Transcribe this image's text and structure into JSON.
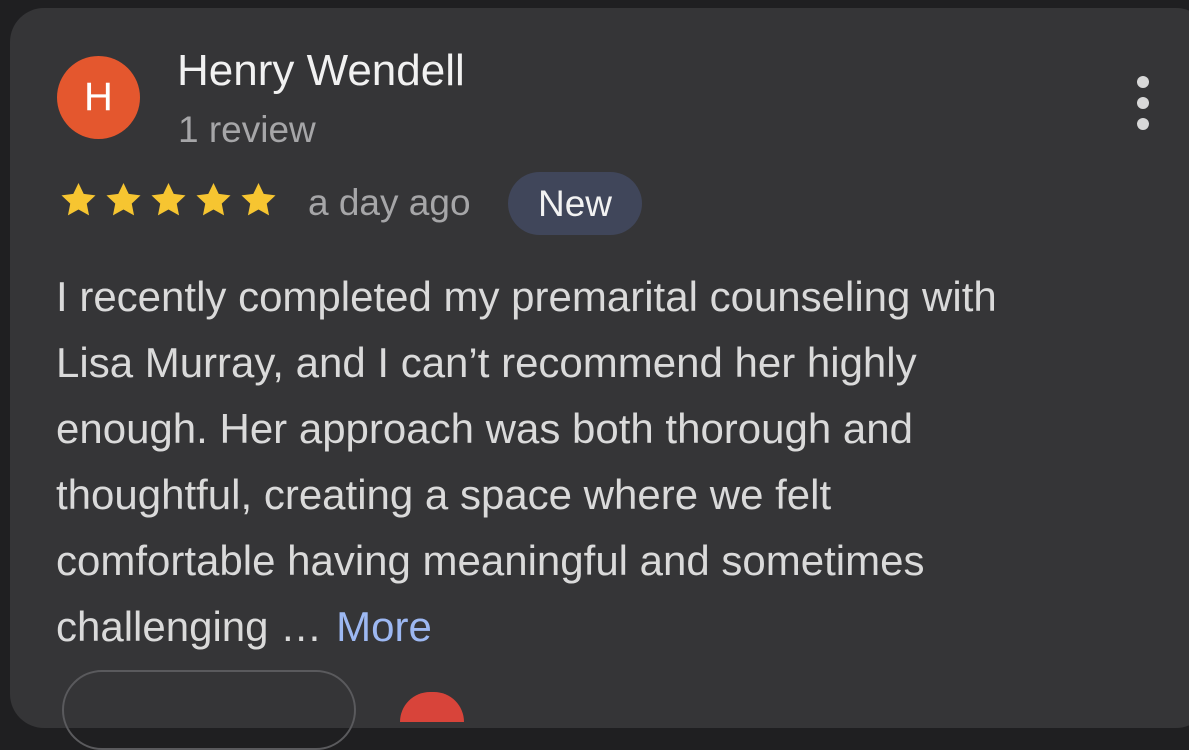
{
  "review": {
    "avatar_letter": "H",
    "author_name": "Henry Wendell",
    "author_meta": "1 review",
    "rating": 5,
    "rating_max": 5,
    "date": "a day ago",
    "badge": "New",
    "body_lines": [
      "I recently completed my premarital counseling with",
      "Lisa Murray, and I can’t recommend her highly",
      "enough. Her approach was both thorough and",
      "thoughtful, creating a space where we felt",
      "comfortable having meaningful and sometimes",
      "challenging …"
    ],
    "more_label": "More"
  },
  "icons": {
    "menu": "more-vertical-icon",
    "star": "star-filled-icon"
  },
  "colors": {
    "background": "#1f1f21",
    "card": "#353537",
    "avatar": "#e4572e",
    "star": "#f6c531",
    "badge_bg": "#40465a",
    "link": "#9db8f2"
  }
}
